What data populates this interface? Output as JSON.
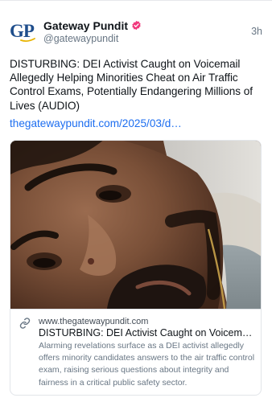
{
  "post": {
    "author_name": "Gateway Pundit",
    "author_handle": "@gatewaypundit",
    "timestamp": "3h",
    "verified_badge_color": "#f0387c",
    "text": "DISTURBING: DEI Activist Caught on Voicemail Allegedly Helping Minorities Cheat on Air Traffic Control Exams, Potentially Endangering Millions of Lives (AUDIO)",
    "link_text": "thegatewaypundit.com/2025/03/d…",
    "link_color": "#1d6ef0"
  },
  "avatar": {
    "logo_text": "GP",
    "logo_color": "#1f4e8c",
    "accent_color": "#e8b400"
  },
  "card": {
    "domain": "www.thegatewaypundit.com",
    "title": "DISTURBING: DEI Activist Caught on Voicemail Allegedly Helping Minorities Cheat on Air Traffic Control Exams, Potentially Endangering Millions of Lives (AUDIO)",
    "description": "Alarming revelations surface as a DEI activist allegedly offers minority candidates answers to the air traffic control exam, raising serious questions about integrity and fairness in a critical public safety sector.",
    "image_subject": "close-up photo of a man's face",
    "icon": "link-icon"
  }
}
